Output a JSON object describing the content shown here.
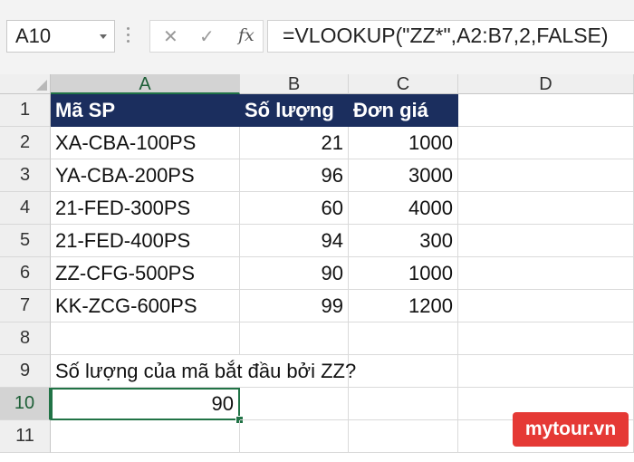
{
  "formula_bar": {
    "name_box": "A10",
    "cancel_icon": "✕",
    "enter_icon": "✓",
    "fx_label": "fx",
    "formula": "=VLOOKUP(\"ZZ*\",A2:B7,2,FALSE)"
  },
  "columns": [
    "A",
    "B",
    "C",
    "D"
  ],
  "rows": [
    {
      "num": "1",
      "a": "Mã SP",
      "b": "Số lượng",
      "c": "Đơn giá"
    },
    {
      "num": "2",
      "a": "XA-CBA-100PS",
      "b": "21",
      "c": "1000"
    },
    {
      "num": "3",
      "a": "YA-CBA-200PS",
      "b": "96",
      "c": "3000"
    },
    {
      "num": "4",
      "a": "21-FED-300PS",
      "b": "60",
      "c": "4000"
    },
    {
      "num": "5",
      "a": "21-FED-400PS",
      "b": "94",
      "c": "300"
    },
    {
      "num": "6",
      "a": "ZZ-CFG-500PS",
      "b": "90",
      "c": "1000"
    },
    {
      "num": "7",
      "a": "KK-ZCG-600PS",
      "b": "99",
      "c": "1200"
    },
    {
      "num": "8",
      "a": "",
      "b": "",
      "c": ""
    },
    {
      "num": "9",
      "a": "Số lượng của mã bắt đầu bởi ZZ?",
      "b": "",
      "c": ""
    },
    {
      "num": "10",
      "a": "90",
      "b": "",
      "c": ""
    },
    {
      "num": "11",
      "a": "",
      "b": "",
      "c": ""
    }
  ],
  "selected_cell": "A10",
  "colors": {
    "header_fill": "#1b2e5e",
    "selection": "#217346",
    "watermark": "#e53935"
  },
  "watermark": "mytour.vn"
}
